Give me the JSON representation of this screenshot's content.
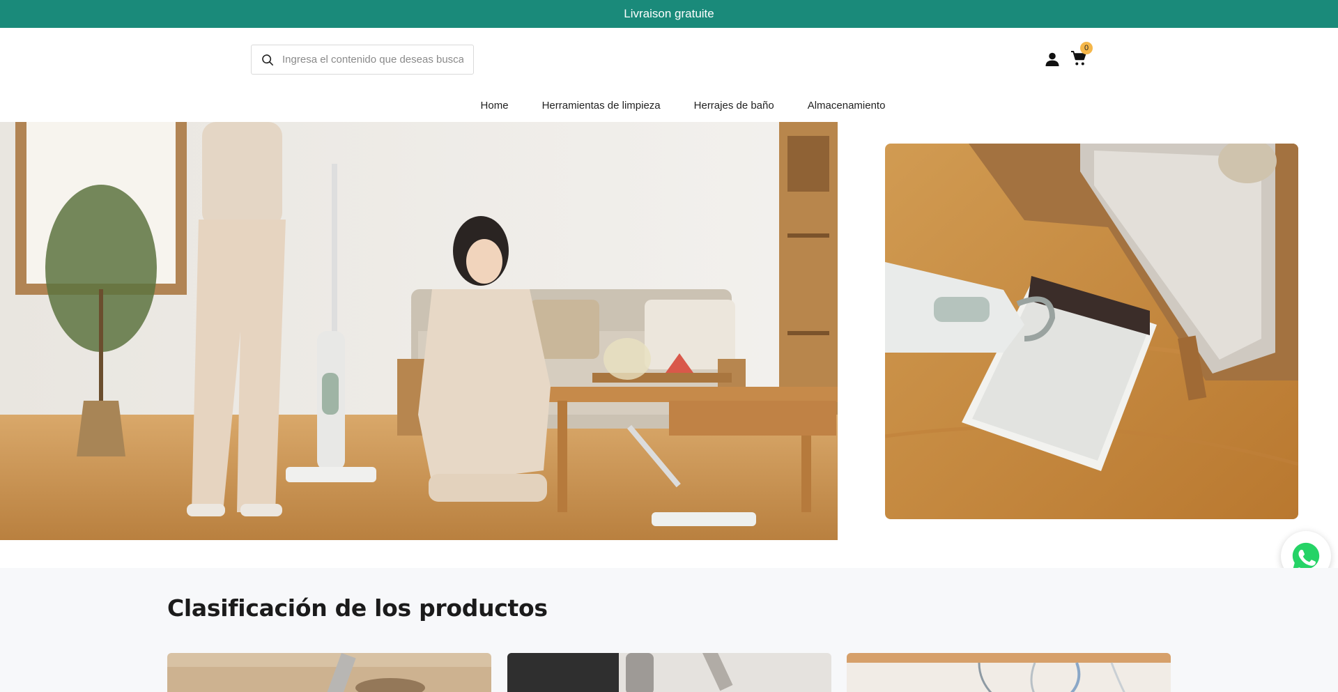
{
  "announcement": {
    "text": "Livraison gratuite"
  },
  "search": {
    "placeholder": "Ingresa el contenido que deseas buscar"
  },
  "header_icons": {
    "account": "user-icon",
    "cart": "cart-icon",
    "cart_count": "0"
  },
  "nav": {
    "items": [
      {
        "label": "Home"
      },
      {
        "label": "Herramientas de limpieza"
      },
      {
        "label": "Herrajes de baño"
      },
      {
        "label": "Almacenamiento"
      }
    ]
  },
  "hero": {
    "left_image": "steam-mop-living-room-photo",
    "right_image": "steam-mop-closeup-photo"
  },
  "floating": {
    "icon": "whatsapp-icon"
  },
  "categories": {
    "title": "Clasificación de los productos",
    "cards": [
      {
        "image": "category-mop-photo"
      },
      {
        "image": "category-bathroom-faucet-photo"
      },
      {
        "image": "category-hangers-photo"
      }
    ]
  },
  "colors": {
    "announcement_bg": "#1a8a7a",
    "badge": "#f5b74a",
    "whatsapp": "#25d366"
  }
}
